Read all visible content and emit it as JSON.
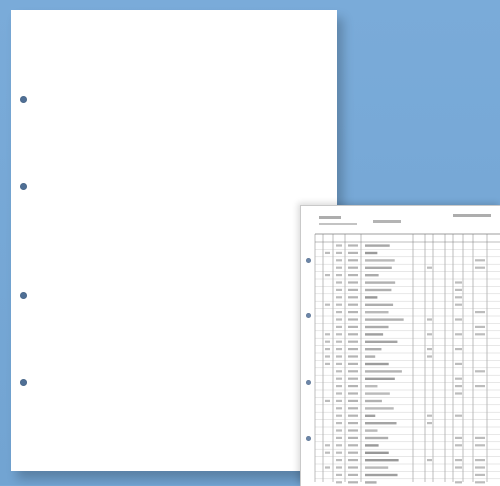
{
  "background_color": "#76a8d6",
  "blank_sheet": {
    "color": "#ffffff",
    "binder_holes": 4,
    "hole_color": "#4f6f95"
  },
  "ledger_sheet": {
    "color": "#ffffff",
    "binder_holes": 4,
    "content_legible": false
  }
}
